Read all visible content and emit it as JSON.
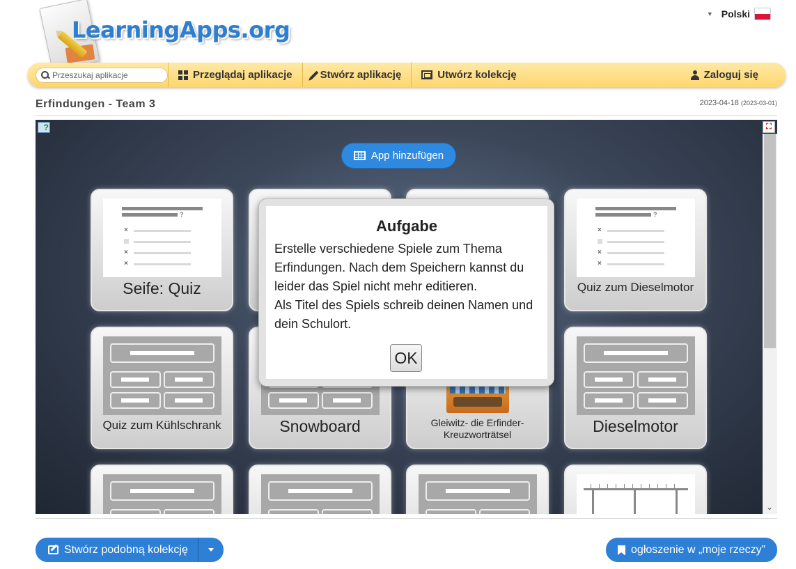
{
  "brand": {
    "logo_text": "LearningApps.org"
  },
  "language": {
    "label": "Polski"
  },
  "navbar": {
    "search_placeholder": "Przeszukaj aplikacje",
    "browse_label": "Przeglądaj aplikacje",
    "create_app_label": "Stwórz aplikację",
    "create_collection_label": "Utwórz kolekcję",
    "login_label": "Zaloguj się"
  },
  "collection": {
    "title": "Erfindungen - Team 3",
    "date_modified": "2023-04-18",
    "date_created": "(2023-03-01)"
  },
  "frame": {
    "add_app_label": "App hinzufügen",
    "cards": [
      {
        "label": "Seife: Quiz",
        "thumb": "quiz"
      },
      {
        "label": "",
        "thumb": "hidden"
      },
      {
        "label": "",
        "thumb": "hidden"
      },
      {
        "label": "Quiz zum Dieselmotor",
        "thumb": "quiz"
      },
      {
        "label": "Quiz zum Kühlschrank",
        "thumb": "grid"
      },
      {
        "label": "Snowboard",
        "thumb": "grid"
      },
      {
        "label": "Gleiwitz- die Erfinder-Kreuzworträtsel",
        "thumb": "crossword"
      },
      {
        "label": "Dieselmotor",
        "thumb": "grid"
      },
      {
        "label": "",
        "thumb": "grid"
      },
      {
        "label": "",
        "thumb": "grid"
      },
      {
        "label": "",
        "thumb": "grid"
      },
      {
        "label": "",
        "thumb": "diagram"
      }
    ]
  },
  "dialog": {
    "title": "Aufgabe",
    "line1": "Erstelle verschiedene Spiele zum Thema Erfindungen. Nach dem Speichern kannst du leider das Spiel nicht mehr editieren.",
    "line2": "Als Titel des Spiels schreib deinen Namen und dein Schulort.",
    "ok_label": "OK"
  },
  "footer": {
    "similar_label": "Stwórz podobną kolekcję",
    "bookmark_label": "ogłoszenie w „moje rzeczy”"
  },
  "colors": {
    "accent_blue": "#2e7fd6",
    "navbar_yellow": "#ffd66e"
  }
}
